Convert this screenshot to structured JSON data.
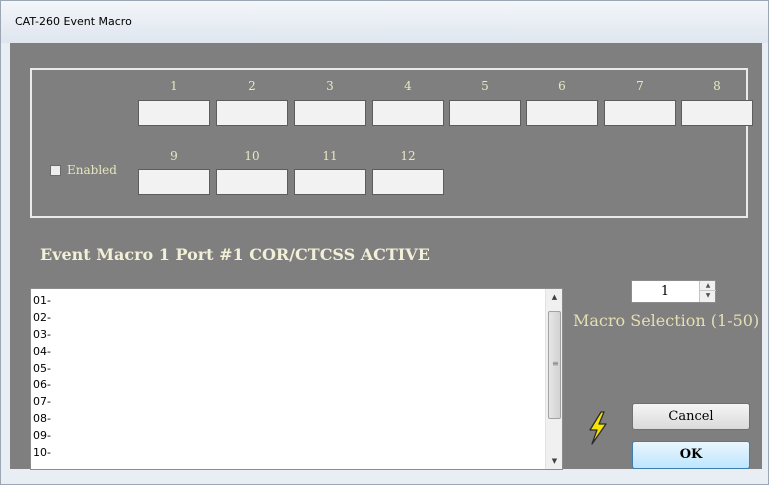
{
  "window": {
    "title": "CAT-260 Event Macro"
  },
  "slots": {
    "labels": [
      "1",
      "2",
      "3",
      "4",
      "5",
      "6",
      "7",
      "8",
      "9",
      "10",
      "11",
      "12"
    ],
    "values": [
      "",
      "",
      "",
      "",
      "",
      "",
      "",
      "",
      "",
      "",
      "",
      ""
    ],
    "enabled_label": "Enabled",
    "enabled_checked": false
  },
  "heading": "Event Macro 1  Port #1 COR/CTCSS ACTIVE",
  "macro_lines": [
    "01-",
    "02-",
    "03-",
    "04-",
    "05-",
    "06-",
    "07-",
    "08-",
    "09-",
    "10-"
  ],
  "macro_selection": {
    "value": "1",
    "label": "Macro Selection (1-50)"
  },
  "buttons": {
    "cancel": "Cancel",
    "ok": "OK"
  },
  "icons": {
    "bolt": "lightning-bolt-icon",
    "scroll_up": "scroll-up-arrow-icon",
    "scroll_down": "scroll-down-arrow-icon",
    "spin_up": "spin-up-arrow-icon",
    "spin_down": "spin-down-arrow-icon"
  },
  "colors": {
    "client_bg": "#7f7f7f",
    "label_text": "#e8e8c0",
    "bolt_fill": "#f5e400"
  }
}
